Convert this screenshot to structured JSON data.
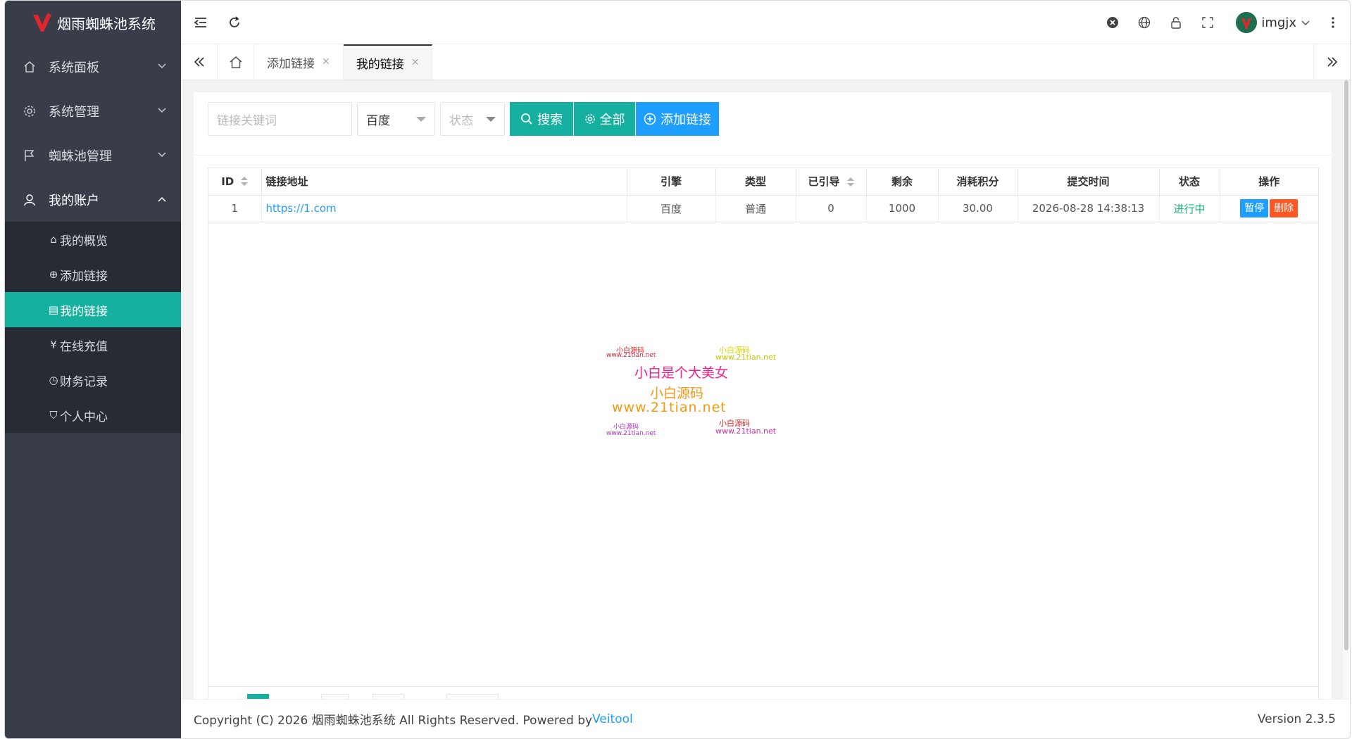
{
  "app": {
    "title": "烟雨蜘蛛池系统",
    "accent": "#16b0a0",
    "sidebar_bg": "#393d49"
  },
  "sidebar": {
    "items": [
      {
        "label": "系统面板",
        "icon": "home-icon"
      },
      {
        "label": "系统管理",
        "icon": "gear-icon"
      },
      {
        "label": "蜘蛛池管理",
        "icon": "flag-icon"
      },
      {
        "label": "我的账户",
        "icon": "user-icon"
      }
    ],
    "sub_items": [
      {
        "label": "我的概览",
        "icon": "home-outline-icon"
      },
      {
        "label": "添加链接",
        "icon": "plus-circle-icon"
      },
      {
        "label": "我的链接",
        "icon": "document-icon"
      },
      {
        "label": "在线充值",
        "icon": "yen-circle-icon"
      },
      {
        "label": "财务记录",
        "icon": "clock-icon"
      },
      {
        "label": "个人中心",
        "icon": "shield-check-icon"
      }
    ]
  },
  "header": {
    "username": "imgjx"
  },
  "tabs": [
    {
      "label": "添加链接"
    },
    {
      "label": "我的链接"
    }
  ],
  "toolbar": {
    "keyword_placeholder": "链接关键词",
    "engine_value": "百度",
    "status_placeholder": "状态",
    "search_label": "搜索",
    "all_label": "全部",
    "add_label": "添加链接"
  },
  "table": {
    "headers": [
      "ID",
      "链接地址",
      "引擎",
      "类型",
      "已引导",
      "剩余",
      "消耗积分",
      "提交时间",
      "状态",
      "操作"
    ],
    "rows": [
      {
        "id": "1",
        "url": "https://1.com",
        "engine": "百度",
        "type": "普通",
        "guided": "0",
        "remaining": "1000",
        "points": "30.00",
        "time": "2026-08-28 14:38:13",
        "status": "进行中",
        "pause": "暂停",
        "delete": "删除"
      }
    ]
  },
  "watermark": {
    "lines": [
      "小白源码",
      "www.21tian.net",
      "小白源码",
      "www.21tian.net",
      "小白是个大美女",
      "小白源码",
      "www.21tian.net",
      "小白源码",
      "www.21tian.net",
      "小白源码",
      "www.21tian.net"
    ]
  },
  "footer": {
    "copyright": "Copyright (C) 2026 烟雨蜘蛛池系统 All Rights Reserved. Powered by ",
    "powered_link": "Veitool",
    "version": "Version 2.3.5"
  }
}
